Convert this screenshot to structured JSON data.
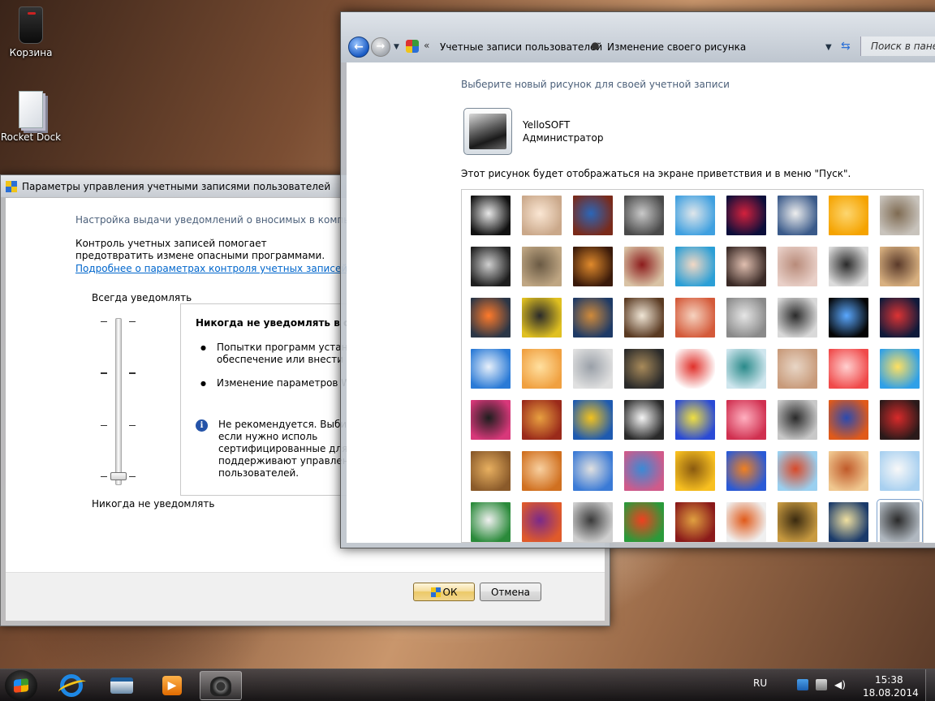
{
  "desktop": {
    "icons": [
      {
        "label": "Корзина",
        "icon": "recycle-bin-icon"
      },
      {
        "label": "Rocket Dock",
        "icon": "document-stack-icon"
      }
    ]
  },
  "uac_window": {
    "title": "Параметры управления учетными записями пользователей",
    "heading": "Настройка выдачи уведомлений о вносимых в компьютер",
    "description": "Контроль учетных записей помогает предотвратить измене опасными программами.",
    "link": "Подробнее о параметрах контроля учетных записей",
    "slider_top_label": "Всегда уведомлять",
    "slider_bottom_label": "Никогда не уведомлять",
    "slider_level": 0,
    "panel": {
      "title": "Никогда не уведомлять в след",
      "bullets": [
        "Попытки программ установ обеспечение или внести из",
        "Изменение параметров Wi"
      ],
      "note": "Не рекомендуется. Выбира только если нужно исполь сертифицированные для W не поддерживают управлен пользователей."
    },
    "buttons": {
      "ok": "ОК",
      "cancel": "Отмена"
    }
  },
  "picture_window": {
    "breadcrumb": [
      "Учетные записи пользователей",
      "Изменение своего рисунка"
    ],
    "search_placeholder": "Поиск в панели",
    "heading": "Выберите новый рисунок для своей учетной записи",
    "user": {
      "name": "YelloSOFT",
      "role": "Администратор"
    },
    "caption": "Этот рисунок будет отображаться на экране приветствия и в меню \"Пуск\".",
    "selected_index": 62,
    "tiles": [
      [
        "#111",
        "#e8e8e8"
      ],
      [
        "#caa88a",
        "#fbe7d4"
      ],
      [
        "#7a2a1a",
        "#2b66b8"
      ],
      [
        "#4a4a4a",
        "#c9c9c9"
      ],
      [
        "#3fa0e0",
        "#e0e6ea"
      ],
      [
        "#0c0e3a",
        "#d4213c"
      ],
      [
        "#3a5a8a",
        "#eeeeee"
      ],
      [
        "#f5a300",
        "#fdd670"
      ],
      [
        "#c8c3bc",
        "#7f6b52"
      ],
      [
        "#1e1e1e",
        "#cfcfcf"
      ],
      [
        "#bfa683",
        "#6a5a44"
      ],
      [
        "#3a1a0a",
        "#e08a2c"
      ],
      [
        "#d9c3a5",
        "#8c1c1c"
      ],
      [
        "#2b9fd6",
        "#f3d8c4"
      ],
      [
        "#3a2a26",
        "#e0bfb0"
      ],
      [
        "#e9d0c8",
        "#b88b7a"
      ],
      [
        "#dcdcdc",
        "#2a2a2a"
      ],
      [
        "#d8b080",
        "#5a3a2a"
      ],
      [
        "#2b3646",
        "#ff7a2a"
      ],
      [
        "#e0c020",
        "#2a2a2a"
      ],
      [
        "#1e3a66",
        "#d08a3a"
      ],
      [
        "#5a3a22",
        "#f0e6d6"
      ],
      [
        "#d45a3a",
        "#f6d3c0"
      ],
      [
        "#8a8a8a",
        "#e6e6e6"
      ],
      [
        "#d9d9d9",
        "#2a2a2a"
      ],
      [
        "#050505",
        "#5aa8ff"
      ],
      [
        "#101a3a",
        "#d33"
      ],
      [
        "#2a7ad6",
        "#e8f0fa"
      ],
      [
        "#f0a040",
        "#ffe0a0"
      ],
      [
        "#e0e0e0",
        "#9aa0a8"
      ],
      [
        "#2a2a2a",
        "#a88a5a"
      ],
      [
        "#ffffff",
        "#e0302a"
      ],
      [
        "#cfe6ee",
        "#2a8a8a"
      ],
      [
        "#c89a7a",
        "#e8d6c6"
      ],
      [
        "#f04a4a",
        "#ffd0d0"
      ],
      [
        "#2fa0e8",
        "#ffe060"
      ],
      [
        "#d8387a",
        "#1e1e1e"
      ],
      [
        "#9a2a1a",
        "#e8a040"
      ],
      [
        "#1e5ab0",
        "#f2c21e"
      ],
      [
        "#2a2a2a",
        "#f5f5f5"
      ],
      [
        "#2a4ad6",
        "#f0e040"
      ],
      [
        "#d03050",
        "#ffb0c0"
      ],
      [
        "#c8c8c8",
        "#2a2a2a"
      ],
      [
        "#e05a1a",
        "#2a4ab0"
      ],
      [
        "#2a1a1a",
        "#d82a2a"
      ],
      [
        "#8a5a2a",
        "#e8b060"
      ],
      [
        "#d07020",
        "#f8d0a0"
      ],
      [
        "#3a7ad6",
        "#e0e0e0"
      ],
      [
        "#d05a8a",
        "#3a8ad6"
      ],
      [
        "#f8c020",
        "#8a5a10"
      ],
      [
        "#2a5ad6",
        "#f08020"
      ],
      [
        "#9ad0f0",
        "#d84a2a"
      ],
      [
        "#f0c890",
        "#c05a2a"
      ],
      [
        "#a8d0f0",
        "#f8f8f8"
      ],
      [
        "#2a8a3a",
        "#f0f0f0"
      ],
      [
        "#e05a2a",
        "#7a2a8a"
      ],
      [
        "#cfcfcf",
        "#3a3a3a"
      ],
      [
        "#2a9a3a",
        "#f04020"
      ],
      [
        "#8a1a1a",
        "#e0a040"
      ],
      [
        "#f0f0f0",
        "#e05a1a"
      ],
      [
        "#c89a40",
        "#3a2a10"
      ],
      [
        "#1a3a6a",
        "#f0e0a0"
      ],
      [
        "#b0b8c0",
        "#2a2a2a"
      ]
    ]
  },
  "taskbar": {
    "language": "RU",
    "time": "15:38",
    "date": "18.08.2014"
  }
}
